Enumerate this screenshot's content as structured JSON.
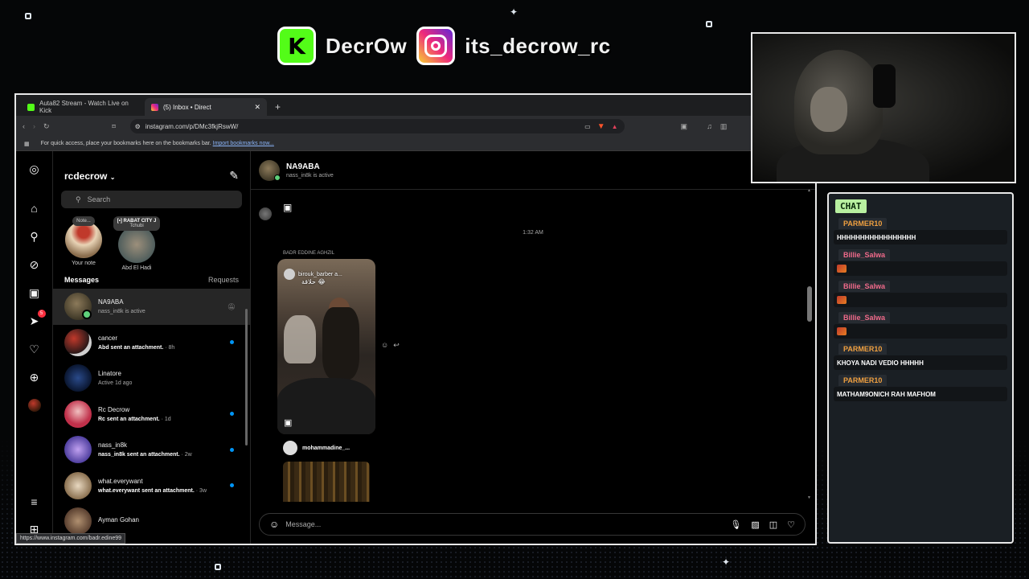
{
  "colors": {
    "kick_green": "#53fc18",
    "chat_green": "#b8f0a0",
    "parmer": "#f0a040",
    "billie": "#f06a8a",
    "unread_blue": "#0095f6",
    "online_green": "#5fd07a"
  },
  "overlay": {
    "kick_name": "DecrOw",
    "instagram_name": "its_decrow_rc"
  },
  "browser": {
    "tabs": [
      {
        "label": "Auta82 Stream - Watch Live on Kick",
        "favicon": "kick-icon"
      },
      {
        "label": "(5) Inbox • Direct",
        "favicon": "instagram-icon"
      }
    ],
    "url": "instagram.com/p/DMc3fkjRswW/",
    "bookmarks_text": "For quick access, place your bookmarks here on the bookmarks bar.",
    "bookmarks_link": "Import bookmarks now...",
    "status_url": "https://www.instagram.com/badr.edine99"
  },
  "rail": {
    "notifications_badge": "5"
  },
  "inbox": {
    "account": "rcdecrow",
    "search_placeholder": "Search",
    "notes": [
      {
        "bubble_title": "",
        "bubble": "Note...",
        "label": "Your note"
      },
      {
        "bubble_title": "[•] RABAT CITY J",
        "bubble": "Tchubi",
        "label": "Abd El Hadi"
      }
    ],
    "messages_title": "Messages",
    "requests_label": "Requests",
    "conversations": [
      {
        "name": "NA9ABA",
        "preview": "nass_in8k is active",
        "bold": false
      },
      {
        "name": "cancer",
        "preview": "Abd sent an attachment.",
        "time": " · 8h",
        "bold": true
      },
      {
        "name": "Linatore",
        "preview": "Active 1d ago",
        "bold": false
      },
      {
        "name": "Rc Decrow",
        "preview": "Rc sent an attachment.",
        "time": " · 1d",
        "bold": true
      },
      {
        "name": "nass_in8k",
        "preview": "nass_in8k sent an attachment.",
        "time": " · 2w",
        "bold": true
      },
      {
        "name": "what.everywant",
        "preview": "what.everywant sent an attachment.",
        "time": " · 3w",
        "bold": true
      },
      {
        "name": "Ayman Gohan",
        "preview": "",
        "bold": false
      }
    ]
  },
  "thread": {
    "name": "NA9ABA",
    "status": "nass_in8k is active",
    "timestamp": "1:32 AM",
    "sender": "BADR EDDINE AGHZIL",
    "reel_user": "birouk_barber a...",
    "reel_caption": "حلاقة 😂",
    "share_user": "mohammadine_...",
    "composer_placeholder": "Message..."
  },
  "chat": {
    "title": "CHAT",
    "messages": [
      {
        "user": "PARMER10",
        "text": "HHHHHHHHHHHHHHHHH",
        "emote": false
      },
      {
        "user": "Billie_Salwa",
        "text": "",
        "emote": true
      },
      {
        "user": "Billie_Salwa",
        "text": "",
        "emote": true
      },
      {
        "user": "Billie_Salwa",
        "text": "",
        "emote": true
      },
      {
        "user": "PARMER10",
        "text": "KHOYA NADI VEDIO HHHHH",
        "emote": false
      },
      {
        "user": "PARMER10",
        "text": "MATHAM9ONICH RAH MAFHOM",
        "emote": false
      }
    ]
  }
}
